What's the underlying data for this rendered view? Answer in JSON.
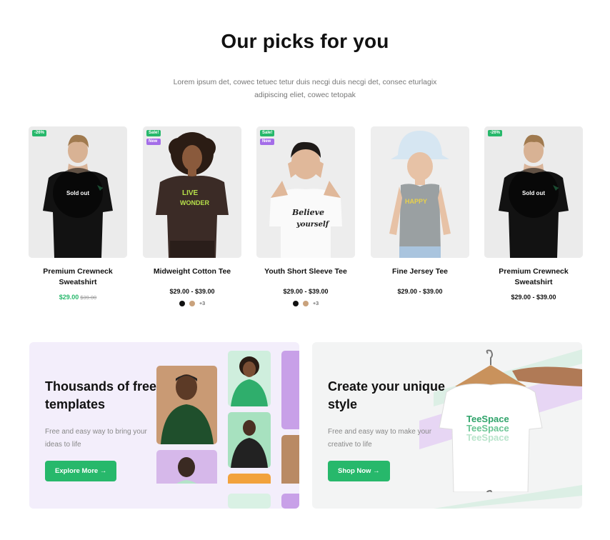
{
  "header": {
    "title": "Our picks for you",
    "subtitle": "Lorem ipsum det, cowec tetuec tetur duis necgi duis necgi det, consec eturlagix adipiscing eliet, cowec tetopak"
  },
  "products": [
    {
      "name": "Premium Crewneck Sweatshirt",
      "badges": [
        "-26%"
      ],
      "overlay": "Sold out",
      "price": "$29.00",
      "old_price": "$39.00"
    },
    {
      "name": "Midweight Cotton Tee",
      "badges": [
        "Sale!",
        "New"
      ],
      "price": "$29.00 - $39.00",
      "more": "+3"
    },
    {
      "name": "Youth Short Sleeve Tee",
      "badges": [
        "Sale!",
        "New"
      ],
      "price": "$29.00 - $39.00",
      "more": "+3"
    },
    {
      "name": "Fine Jersey Tee",
      "badges": [],
      "price": "$29.00 - $39.00"
    },
    {
      "name": "Premium Crewneck Sweatshirt",
      "badges": [
        "-26%"
      ],
      "overlay": "Sold out",
      "price": "$29.00 - $39.00"
    }
  ],
  "banners": [
    {
      "title": "Thousands of free templates",
      "text": "Free and easy way to bring your ideas to life",
      "button": "Explore More →"
    },
    {
      "title": "Create your unique style",
      "text": "Free and easy way to make your creative to life",
      "button": "Shop Now →"
    }
  ],
  "colors": {
    "accent": "#27b86b",
    "new_badge": "#a46de8"
  }
}
